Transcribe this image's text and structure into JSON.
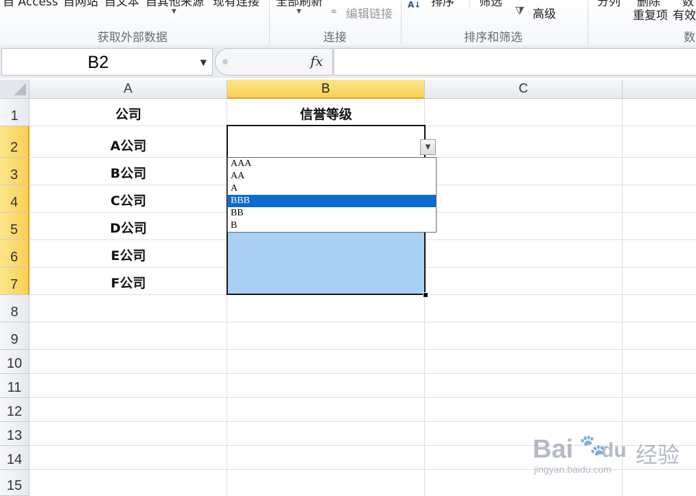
{
  "ribbon": {
    "top_row_clipped": [
      "自 Access",
      "自网站",
      "自文本",
      "自其他来源",
      "现有连接",
      "全部刷新",
      "排序",
      "筛选",
      "分列",
      "删除",
      "数"
    ],
    "edit_links": "编辑链接",
    "advanced": "高级",
    "remove_dup": "重复项",
    "data_valid": "有效",
    "groups": [
      "获取外部数据",
      "连接",
      "排序和筛选",
      "数"
    ]
  },
  "formula_bar": {
    "name_box": "B2",
    "fx": "fx",
    "formula": ""
  },
  "columns": [
    "A",
    "B",
    "C"
  ],
  "rows": [
    "1",
    "2",
    "3",
    "4",
    "5",
    "6",
    "7",
    "8",
    "9",
    "10",
    "11",
    "12",
    "13",
    "14",
    "15"
  ],
  "cells": {
    "A1": "公司",
    "B1": "信誉等级",
    "A2": "A公司",
    "A3": "B公司",
    "A4": "C公司",
    "A5": "D公司",
    "A6": "E公司",
    "A7": "F公司"
  },
  "dropdown": {
    "options": [
      "AAA",
      "AA",
      "A",
      "BBB",
      "BB",
      "B"
    ],
    "highlighted": "BBB"
  },
  "colors": {
    "selection_fill": "#a9d0f2",
    "highlight": "#0a6bd1",
    "header_selected": "#f9cf55"
  },
  "watermark": {
    "brand": "Bai",
    "brand2": "du",
    "sub": "经验",
    "url": "jingyan.baidu.com"
  }
}
